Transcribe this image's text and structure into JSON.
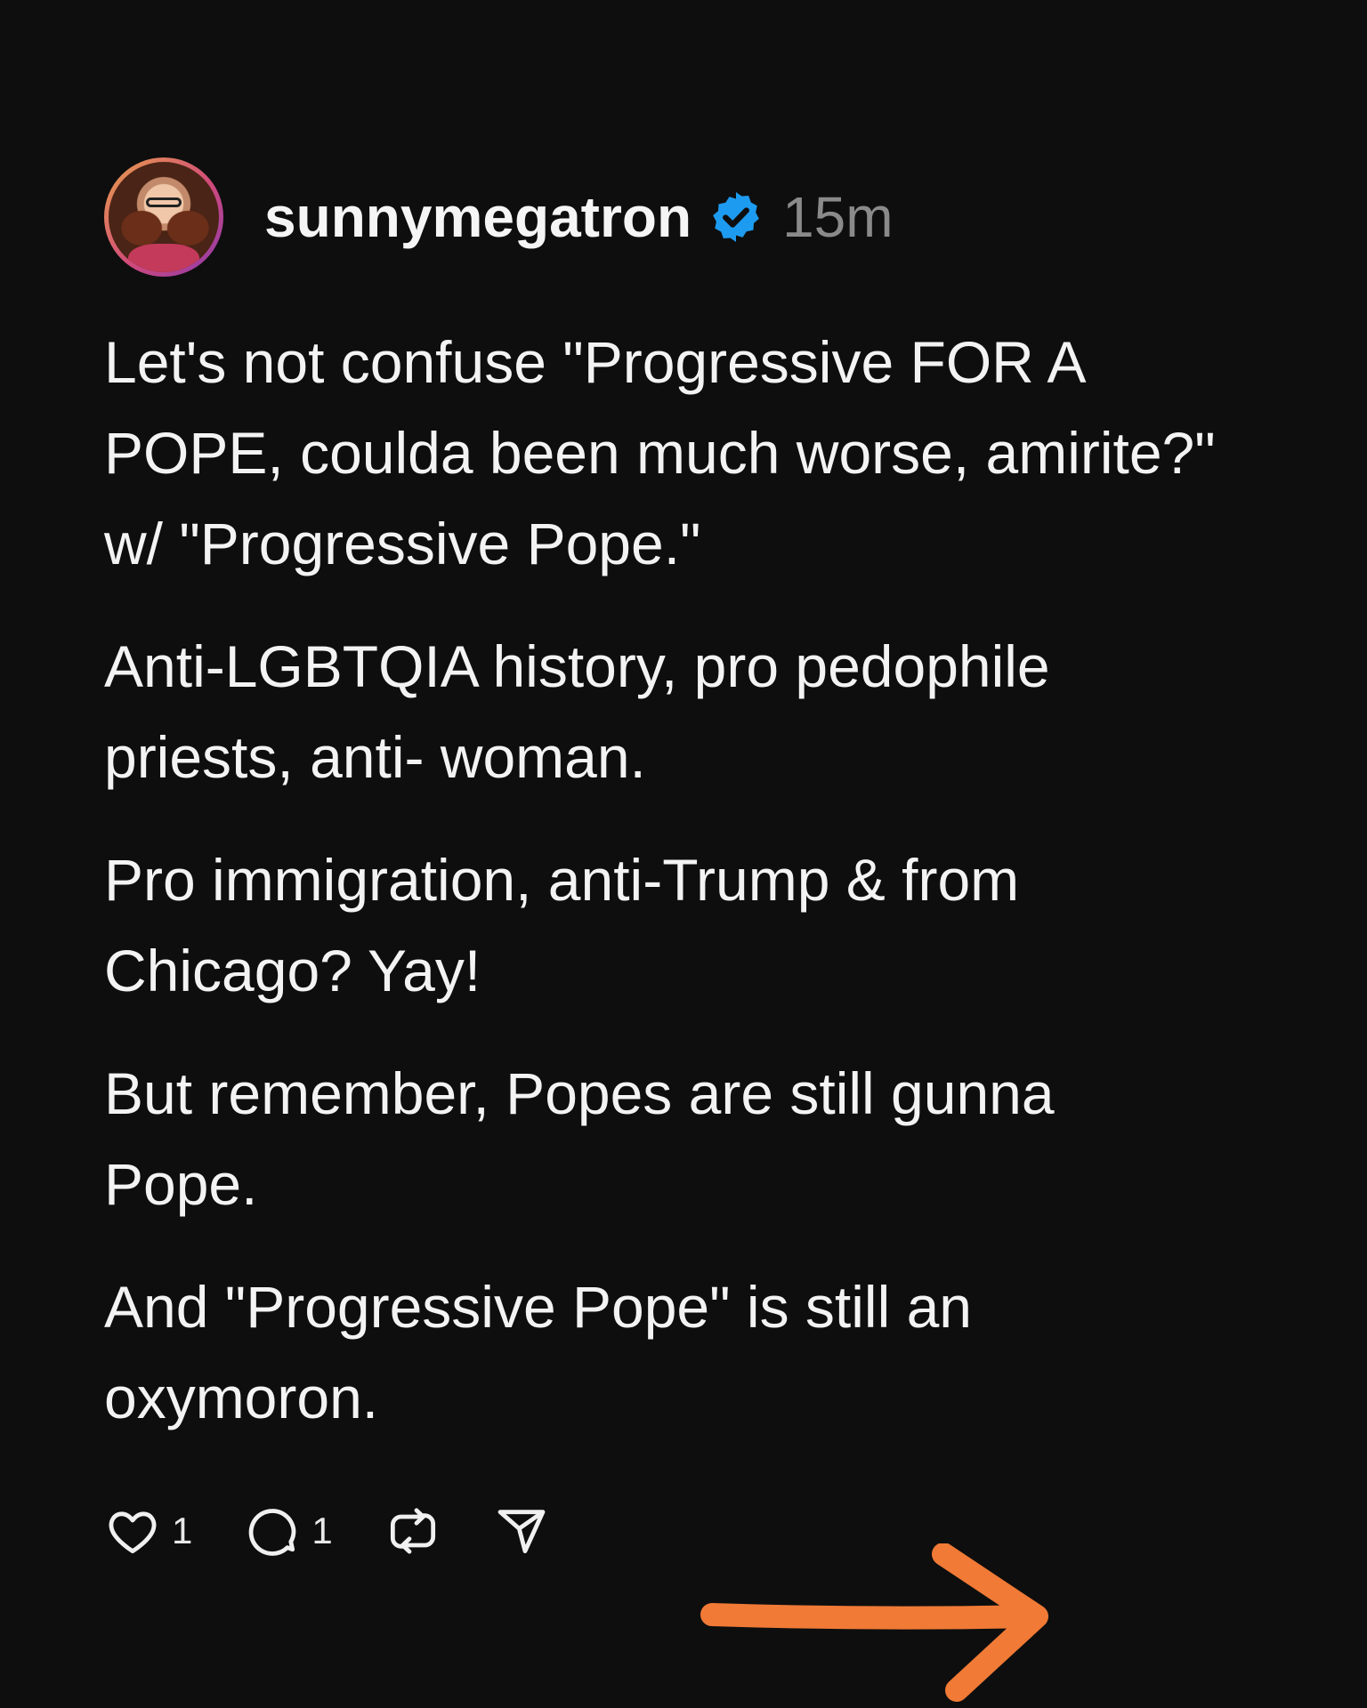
{
  "post": {
    "username": "sunnymegatron",
    "timestamp": "15m",
    "paragraphs": [
      "Let's not confuse \"Progressive FOR A POPE, coulda been much worse, amirite?\" w/ \"Progressive Pope.\"",
      "Anti-LGBTQIA history, pro pedophile priests, anti- woman.",
      "Pro immigration, anti-Trump & from Chicago? Yay!",
      "But remember, Popes are still gunna Pope.",
      "And \"Progressive Pope\" is still an oxymoron."
    ],
    "likes_count": "1",
    "replies_count": "1"
  },
  "icons": {
    "verified": "verified-badge-icon",
    "like": "heart-icon",
    "reply": "comment-bubble-icon",
    "repost": "repost-icon",
    "share": "send-icon",
    "annotation": "arrow-right-icon"
  },
  "colors": {
    "background": "#0e0e0e",
    "text": "#f3f3f3",
    "timestamp": "#8a8a8a",
    "verified_badge": "#1d9bf0",
    "annotation_arrow": "#f07a36"
  }
}
